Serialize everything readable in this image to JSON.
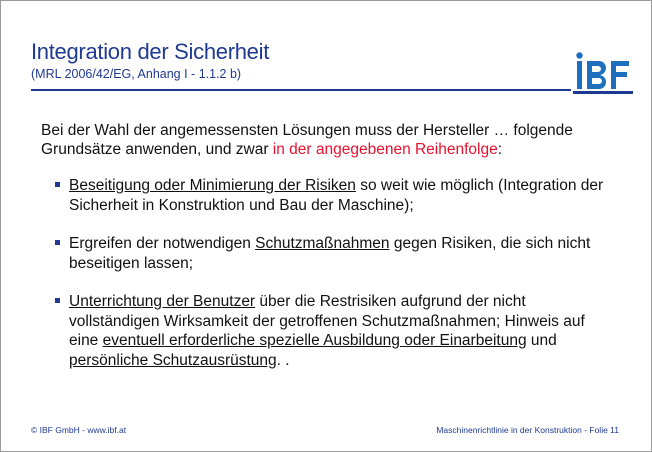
{
  "header": {
    "title": "Integration der Sicherheit",
    "subtitle": "(MRL 2006/42/EG, Anhang I - 1.1.2 b)",
    "logo_text": "IBF"
  },
  "colors": {
    "accent": "#1f3a93",
    "highlight": "#e8112d",
    "logo_blue": "#1f6fbf"
  },
  "intro": {
    "text": "Bei der Wahl der angemessensten Lösungen muss der Hersteller … folgende Grundsätze anwenden, und zwar ",
    "highlight": "in der angegebenen Reihenfolge",
    "end": ":"
  },
  "bullets": [
    {
      "u1": "Beseitigung oder Minimierung der Risiken",
      "t1": " so weit wie möglich (Integration der Sicherheit in Konstruktion und Bau der Maschine);"
    },
    {
      "t0": "Ergreifen der notwendigen ",
      "u1": "Schutzmaßnahmen",
      "t1": " gegen Risiken, die sich nicht beseitigen lassen;"
    },
    {
      "u1": "Unterrichtung der Benutzer",
      "t1": " über die Restrisiken aufgrund der nicht vollständigen Wirksamkeit der getroffenen Schutzmaßnahmen; Hinweis auf eine ",
      "u2": "eventuell erforderliche spezielle Ausbildung oder Einarbeitung",
      "t2": " und ",
      "u3": "persönliche Schutzausrüstung",
      "t3": ". ."
    }
  ],
  "footer": {
    "left": "© IBF GmbH - www.ibf.at",
    "right": "Maschinenrichtlinie in der Konstruktion - Folie 11"
  }
}
